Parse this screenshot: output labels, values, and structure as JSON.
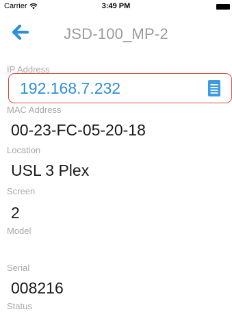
{
  "status_bar": {
    "carrier": "Carrier",
    "time": "3:49 PM"
  },
  "nav": {
    "title": "JSD-100_MP-2"
  },
  "fields": {
    "ip_label": "IP Address",
    "ip_value": "192.168.7.232",
    "mac_label": "MAC Address",
    "mac_value": "00-23-FC-05-20-18",
    "location_label": "Location",
    "location_value": "USL 3 Plex",
    "screen_label": "Screen",
    "screen_value": "2",
    "model_label": "Model",
    "model_value": "",
    "serial_label": "Serial",
    "serial_value": "008216",
    "status_label": "Status"
  },
  "colors": {
    "accent": "#2c8fd8",
    "highlight_border": "#d9463b",
    "label": "#a8a8a8"
  },
  "icons": {
    "back": "arrow-left-icon",
    "copy": "document-icon",
    "wifi": "wifi-icon",
    "battery": "battery-icon"
  }
}
